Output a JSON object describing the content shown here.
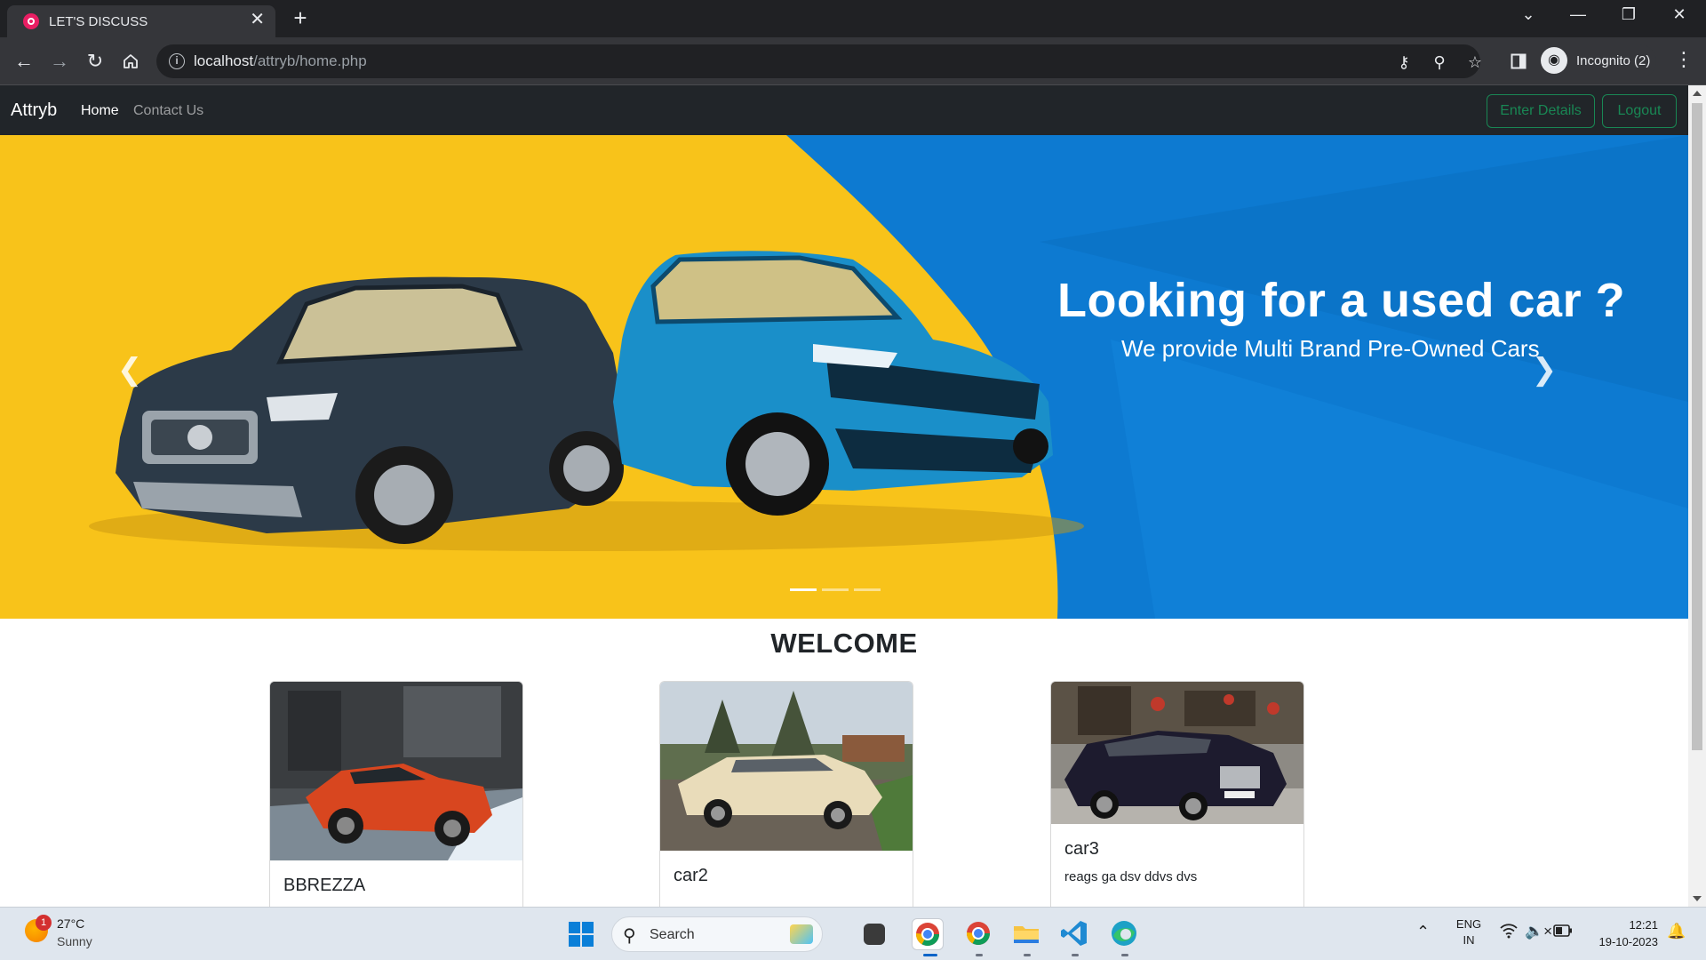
{
  "browser": {
    "tab_title": "LET'S DISCUSS",
    "tab_close": "✕",
    "new_tab": "+",
    "url_host": "localhost",
    "url_path": "/attryb/home.php",
    "incognito_label": "Incognito (2)",
    "window_controls": {
      "tab_search": "⌄",
      "minimize": "—",
      "restore": "❐",
      "close": "✕"
    }
  },
  "site": {
    "brand": "Attryb",
    "nav": [
      {
        "label": "Home",
        "active": true
      },
      {
        "label": "Contact Us",
        "active": false
      }
    ],
    "buttons": {
      "enter_details": "Enter Details",
      "logout": "Logout"
    },
    "hero": {
      "title": "Looking for a used car ?",
      "subtitle": "We provide Multi Brand Pre-Owned Cars",
      "slide_count": 3,
      "active_slide": 1
    },
    "welcome": "WELCOME",
    "cards": [
      {
        "title": "BBREZZA",
        "text": ""
      },
      {
        "title": "car2",
        "text": ""
      },
      {
        "title": "car3",
        "text": "reags ga dsv ddvs dvs"
      }
    ],
    "colors": {
      "accent_green": "#198754",
      "navbar": "#212529",
      "hero_yellow": "#f8c31a",
      "hero_blue": "#0d7ad1"
    }
  },
  "taskbar": {
    "weather_badge": "1",
    "temperature": "27°C",
    "condition": "Sunny",
    "search_label": "Search",
    "lang_line1": "ENG",
    "lang_line2": "IN",
    "time": "12:21",
    "date": "19-10-2023"
  }
}
